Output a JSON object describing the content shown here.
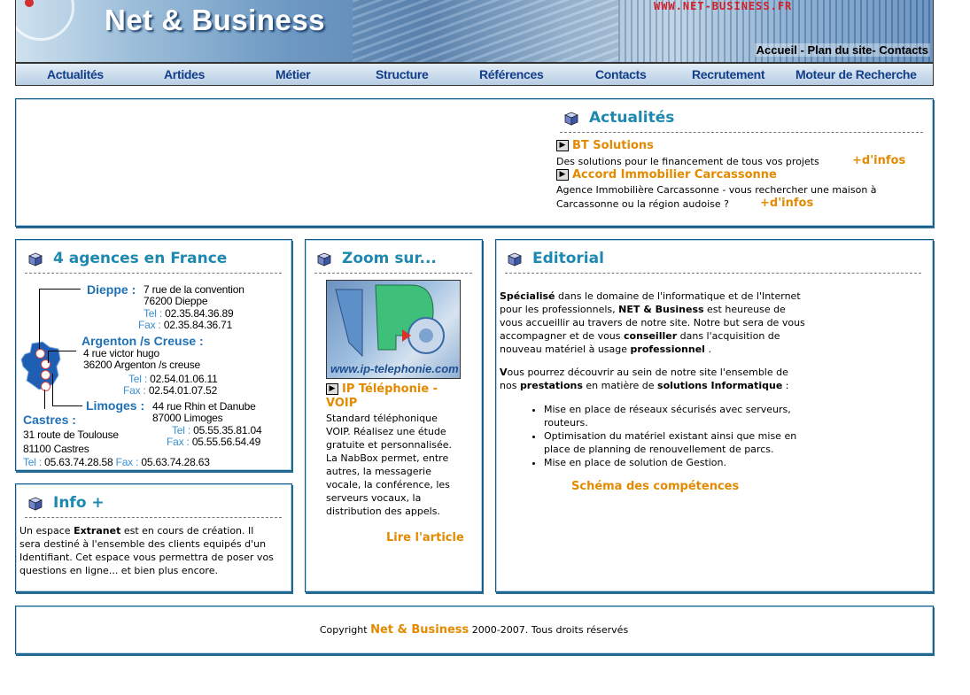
{
  "header": {
    "brand": "Net & Business",
    "url": "WWW.NET-BUSINESS.FR",
    "toplinks": [
      "Accueil",
      " - ",
      "Plan du site",
      "- ",
      "Contacts"
    ]
  },
  "nav": [
    "Actualités",
    "Artides",
    "Métier",
    "Structure",
    "Références",
    "Contacts",
    "Recrutement",
    "Moteur de Recherche"
  ],
  "actualites": {
    "title": "Actualités",
    "items": [
      {
        "title": "BT Solutions",
        "text": "Des solutions pour le financement de tous vos projets",
        "more": "+d'infos"
      },
      {
        "title": "Accord Immobilier Carcassonne",
        "text1": "Agence Immobilière Carcassonne - vous rechercher une maison à",
        "text2": "Carcassonne ou la région audoise ?",
        "more": "+d'infos"
      }
    ]
  },
  "agences": {
    "title": "4 agences en France",
    "dieppe": {
      "city": "Dieppe :",
      "addr1": "7 rue de la convention",
      "addr2": "76200 Dieppe",
      "tel_label": "Tel :",
      "tel": "02.35.84.36.89",
      "fax_label": "Fax :",
      "fax": "02.35.84.36.71"
    },
    "argenton": {
      "city": "Argenton /s Creuse :",
      "addr1": "4 rue victor hugo",
      "addr2": "36200 Argenton /s creuse",
      "tel_label": "Tel :",
      "tel": "02.54.01.06.11",
      "fax_label": "Fax :",
      "fax": "02.54.01.07.52"
    },
    "limoges": {
      "city": "Limoges :",
      "addr1": "44 rue Rhin et Danube",
      "addr2": "87000 Limoges",
      "tel_label": "Tel :",
      "tel": "05.55.35.81.04",
      "fax_label": "Fax :",
      "fax": "05.55.56.54.49"
    },
    "castres": {
      "city": "Castres :",
      "addr1": "31 route de Toulouse",
      "addr2": "81100 Castres",
      "tel_label": "Tel :",
      "tel": "05.63.74.28.58",
      "fax_label": "Fax :",
      "fax": "05.63.74.28.63"
    }
  },
  "info": {
    "title": "Info +",
    "lines": [
      [
        "Un espace ",
        "Extranet",
        " est en cours de création. Il"
      ],
      "sera destiné à l'ensemble des clients equipés d'un",
      "Identifiant. Cet espace vous permettra de poser vos",
      "questions en ligne... et bien plus encore."
    ]
  },
  "zoom": {
    "title": "Zoom sur...",
    "image_caption": "www.ip-telephonie.com",
    "article_title_1": "IP Téléphonie -",
    "article_title_2": "VOIP",
    "text": [
      "Standard téléphonique",
      "VOIP. Réalisez une étude",
      "gratuite et personnalisée.",
      "La NabBox permet, entre",
      "autres, la messagerie",
      "vocale, la conférence, les",
      "serveurs vocaux, la",
      "distribution des appels."
    ],
    "read_more": "Lire l'article"
  },
  "editorial": {
    "title": "Editorial",
    "p1": [
      [
        "Spécialisé",
        " dans le domaine de l'informatique et de l'Internet"
      ],
      [
        "pour les professionnels, ",
        "NET & Business",
        " est heureuse de"
      ],
      [
        "vous accueillir au travers de notre site. Notre but sera de vous"
      ],
      [
        "accompagner et de vous ",
        "conseiller",
        " dans l'acquisition de"
      ],
      [
        "nouveau matériel à usage ",
        "professionnel",
        " ."
      ]
    ],
    "p2": [
      [
        "V",
        "ous pourrez découvrir au sein de notre site l'ensemble de"
      ],
      [
        "nos ",
        "prestations",
        " en matière de ",
        "solutions Informatique",
        " :"
      ]
    ],
    "bullets": [
      [
        "Mise en place de réseaux sécurisés avec serveurs,",
        "routeurs."
      ],
      [
        "Optimisation du matériel existant ainsi que mise en",
        "place de planning de renouvellement de parcs."
      ],
      [
        "Mise en place de solution de Gestion."
      ]
    ],
    "link": "Schéma des compétences"
  },
  "footer": {
    "prefix": "Copyright ",
    "brand": "Net & Business",
    "suffix": " 2000-2007. Tous droits réservés"
  },
  "colors": {
    "title_blue": "#1e89b0",
    "orange": "#e38a00",
    "nav_blue": "#123e8a",
    "border": "#0e5a86"
  }
}
